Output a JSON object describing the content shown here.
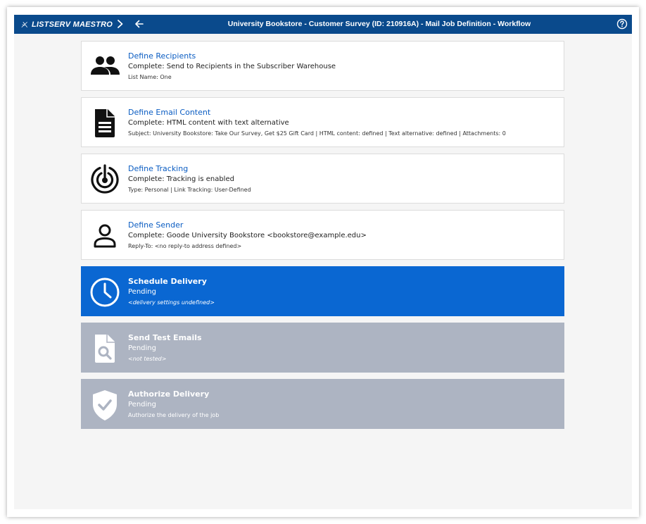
{
  "header": {
    "brand": "LISTSERV MAESTRO",
    "title": "University Bookstore - Customer Survey (ID: 210916A) - Mail Job Definition - Workflow",
    "icons": [
      "maestro-logo-icon",
      "chevron-right-icon",
      "arrow-left-icon",
      "help-icon"
    ]
  },
  "colors": {
    "topbar": "#0a4a8c",
    "link": "#0a5cc2",
    "active": "#0a67d2",
    "disabled": "#adb4c2"
  },
  "steps": [
    {
      "title": "Define Recipients",
      "status": "Complete: Send to Recipients in the Subscriber Warehouse",
      "detail": "List Name: One",
      "icon": "people-icon",
      "state": "complete"
    },
    {
      "title": "Define Email Content",
      "status": "Complete: HTML content with text alternative",
      "detail": "Subject: University Bookstore: Take Our Survey, Get $25 Gift Card | HTML content: defined | Text alternative: defined | Attachments: 0",
      "icon": "document-icon",
      "state": "complete"
    },
    {
      "title": "Define Tracking",
      "status": "Complete: Tracking is enabled",
      "detail": "Type: Personal | Link Tracking: User-Defined",
      "icon": "target-icon",
      "state": "complete"
    },
    {
      "title": "Define Sender",
      "status": "Complete: Goode University Bookstore <bookstore@example.edu>",
      "detail": "Reply-To: <no reply-to address defined>",
      "icon": "person-icon",
      "state": "complete"
    },
    {
      "title": "Schedule Delivery",
      "status": "Pending",
      "detail": "<delivery settings undefined>",
      "icon": "clock-icon",
      "state": "active"
    },
    {
      "title": "Send Test Emails",
      "status": "Pending",
      "detail": "<not tested>",
      "icon": "document-search-icon",
      "state": "disabled"
    },
    {
      "title": "Authorize Delivery",
      "status": "Pending",
      "detail": "Authorize the delivery of the job",
      "icon": "shield-check-icon",
      "state": "disabled"
    }
  ]
}
